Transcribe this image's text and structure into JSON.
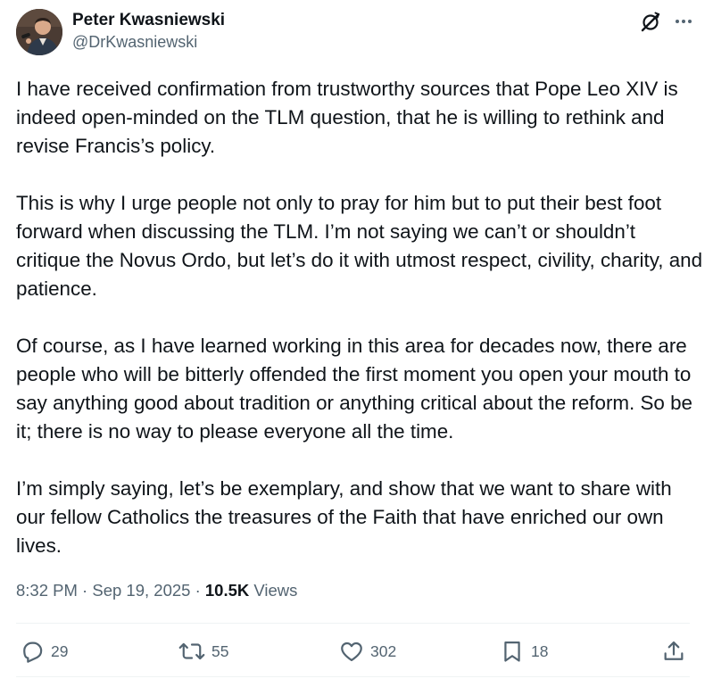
{
  "author": {
    "display_name": "Peter Kwasniewski",
    "handle": "@DrKwasniewski"
  },
  "header_icons": {
    "grok": "grok-icon",
    "more": "more-icon"
  },
  "post": {
    "paragraphs": [
      "I have received confirmation from trustworthy sources that Pope Leo XIV is indeed open-minded on the TLM question, that he is willing to rethink and revise Francis’s policy.",
      "This is why I urge people not only to pray for him but to put their best foot forward when discussing the TLM. I’m not saying we can’t or shouldn’t critique the Novus Ordo, but let’s do it with utmost respect, civility, charity, and patience.",
      "Of course, as I have learned working in this area for decades now, there are people who will be bitterly offended the first moment you open your mouth to say anything good about tradition or anything critical about the reform. So be it; there is no way to please everyone all the time.",
      "I’m simply saying, let’s be exemplary, and show that we want to share with our fellow Catholics the treasures of the Faith that have enriched our own lives."
    ]
  },
  "meta": {
    "time": "8:32 PM",
    "separator": "·",
    "date": "Sep 19, 2025",
    "views_count": "10.5K",
    "views_label": "Views"
  },
  "actions": {
    "replies": "29",
    "reposts": "55",
    "likes": "302",
    "bookmarks": "18"
  },
  "colors": {
    "text": "#0f1419",
    "secondary": "#536471",
    "divider": "#eff3f4"
  }
}
